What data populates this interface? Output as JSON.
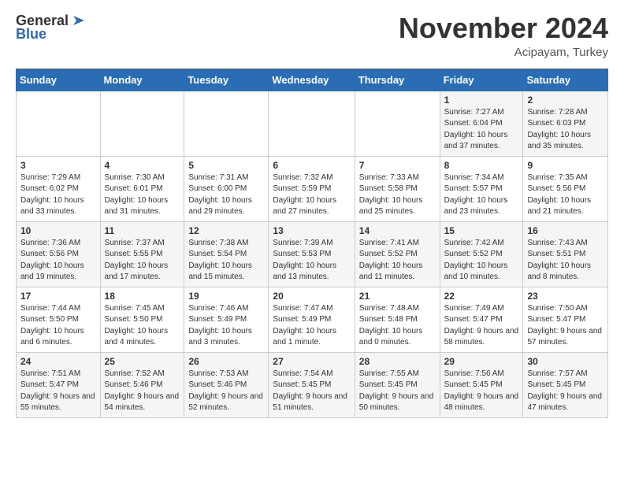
{
  "header": {
    "logo_line1": "General",
    "logo_line2": "Blue",
    "month_title": "November 2024",
    "location": "Acipayam, Turkey"
  },
  "days_of_week": [
    "Sunday",
    "Monday",
    "Tuesday",
    "Wednesday",
    "Thursday",
    "Friday",
    "Saturday"
  ],
  "weeks": [
    [
      {
        "day": "",
        "info": ""
      },
      {
        "day": "",
        "info": ""
      },
      {
        "day": "",
        "info": ""
      },
      {
        "day": "",
        "info": ""
      },
      {
        "day": "",
        "info": ""
      },
      {
        "day": "1",
        "info": "Sunrise: 7:27 AM\nSunset: 6:04 PM\nDaylight: 10 hours and 37 minutes."
      },
      {
        "day": "2",
        "info": "Sunrise: 7:28 AM\nSunset: 6:03 PM\nDaylight: 10 hours and 35 minutes."
      }
    ],
    [
      {
        "day": "3",
        "info": "Sunrise: 7:29 AM\nSunset: 6:02 PM\nDaylight: 10 hours and 33 minutes."
      },
      {
        "day": "4",
        "info": "Sunrise: 7:30 AM\nSunset: 6:01 PM\nDaylight: 10 hours and 31 minutes."
      },
      {
        "day": "5",
        "info": "Sunrise: 7:31 AM\nSunset: 6:00 PM\nDaylight: 10 hours and 29 minutes."
      },
      {
        "day": "6",
        "info": "Sunrise: 7:32 AM\nSunset: 5:59 PM\nDaylight: 10 hours and 27 minutes."
      },
      {
        "day": "7",
        "info": "Sunrise: 7:33 AM\nSunset: 5:58 PM\nDaylight: 10 hours and 25 minutes."
      },
      {
        "day": "8",
        "info": "Sunrise: 7:34 AM\nSunset: 5:57 PM\nDaylight: 10 hours and 23 minutes."
      },
      {
        "day": "9",
        "info": "Sunrise: 7:35 AM\nSunset: 5:56 PM\nDaylight: 10 hours and 21 minutes."
      }
    ],
    [
      {
        "day": "10",
        "info": "Sunrise: 7:36 AM\nSunset: 5:56 PM\nDaylight: 10 hours and 19 minutes."
      },
      {
        "day": "11",
        "info": "Sunrise: 7:37 AM\nSunset: 5:55 PM\nDaylight: 10 hours and 17 minutes."
      },
      {
        "day": "12",
        "info": "Sunrise: 7:38 AM\nSunset: 5:54 PM\nDaylight: 10 hours and 15 minutes."
      },
      {
        "day": "13",
        "info": "Sunrise: 7:39 AM\nSunset: 5:53 PM\nDaylight: 10 hours and 13 minutes."
      },
      {
        "day": "14",
        "info": "Sunrise: 7:41 AM\nSunset: 5:52 PM\nDaylight: 10 hours and 11 minutes."
      },
      {
        "day": "15",
        "info": "Sunrise: 7:42 AM\nSunset: 5:52 PM\nDaylight: 10 hours and 10 minutes."
      },
      {
        "day": "16",
        "info": "Sunrise: 7:43 AM\nSunset: 5:51 PM\nDaylight: 10 hours and 8 minutes."
      }
    ],
    [
      {
        "day": "17",
        "info": "Sunrise: 7:44 AM\nSunset: 5:50 PM\nDaylight: 10 hours and 6 minutes."
      },
      {
        "day": "18",
        "info": "Sunrise: 7:45 AM\nSunset: 5:50 PM\nDaylight: 10 hours and 4 minutes."
      },
      {
        "day": "19",
        "info": "Sunrise: 7:46 AM\nSunset: 5:49 PM\nDaylight: 10 hours and 3 minutes."
      },
      {
        "day": "20",
        "info": "Sunrise: 7:47 AM\nSunset: 5:49 PM\nDaylight: 10 hours and 1 minute."
      },
      {
        "day": "21",
        "info": "Sunrise: 7:48 AM\nSunset: 5:48 PM\nDaylight: 10 hours and 0 minutes."
      },
      {
        "day": "22",
        "info": "Sunrise: 7:49 AM\nSunset: 5:47 PM\nDaylight: 9 hours and 58 minutes."
      },
      {
        "day": "23",
        "info": "Sunrise: 7:50 AM\nSunset: 5:47 PM\nDaylight: 9 hours and 57 minutes."
      }
    ],
    [
      {
        "day": "24",
        "info": "Sunrise: 7:51 AM\nSunset: 5:47 PM\nDaylight: 9 hours and 55 minutes."
      },
      {
        "day": "25",
        "info": "Sunrise: 7:52 AM\nSunset: 5:46 PM\nDaylight: 9 hours and 54 minutes."
      },
      {
        "day": "26",
        "info": "Sunrise: 7:53 AM\nSunset: 5:46 PM\nDaylight: 9 hours and 52 minutes."
      },
      {
        "day": "27",
        "info": "Sunrise: 7:54 AM\nSunset: 5:45 PM\nDaylight: 9 hours and 51 minutes."
      },
      {
        "day": "28",
        "info": "Sunrise: 7:55 AM\nSunset: 5:45 PM\nDaylight: 9 hours and 50 minutes."
      },
      {
        "day": "29",
        "info": "Sunrise: 7:56 AM\nSunset: 5:45 PM\nDaylight: 9 hours and 48 minutes."
      },
      {
        "day": "30",
        "info": "Sunrise: 7:57 AM\nSunset: 5:45 PM\nDaylight: 9 hours and 47 minutes."
      }
    ]
  ]
}
